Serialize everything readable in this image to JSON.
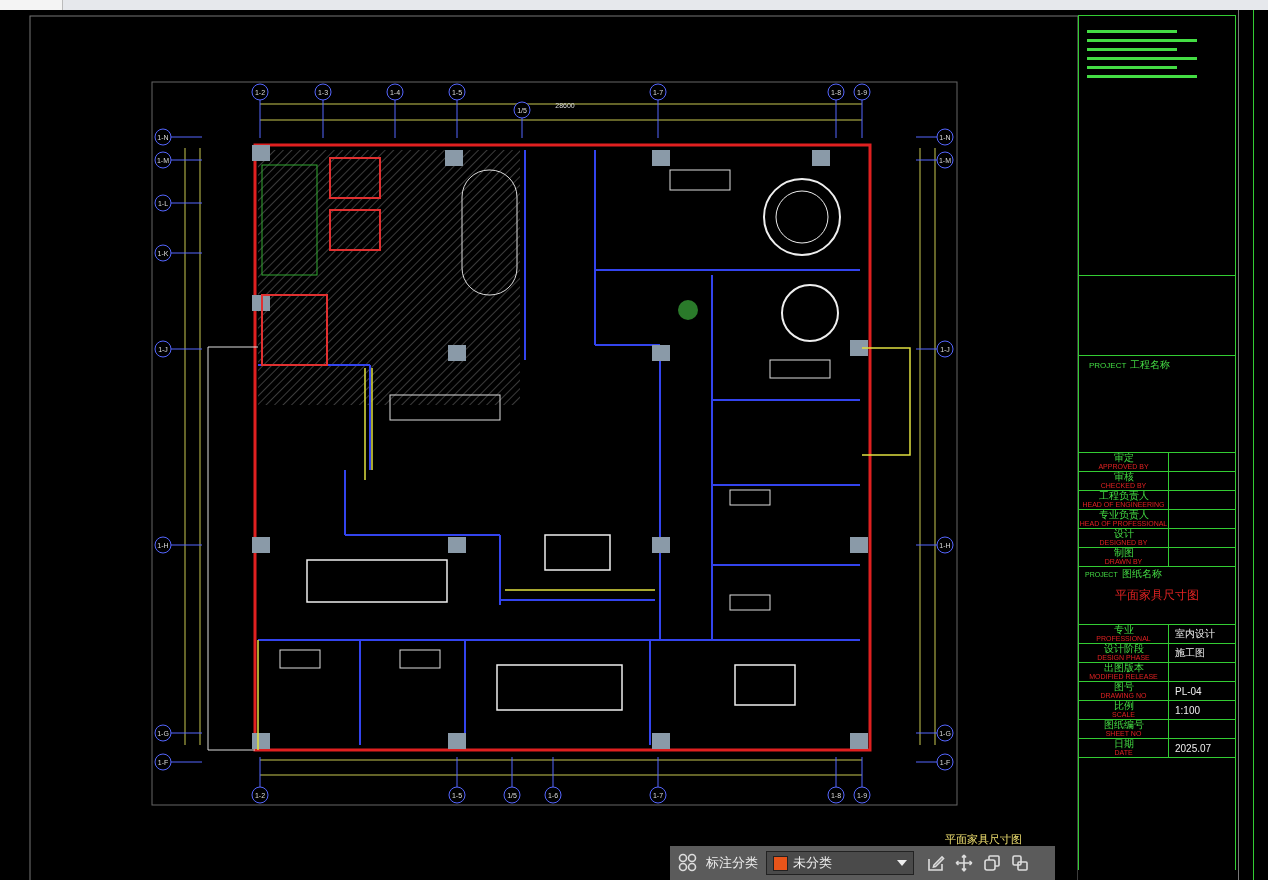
{
  "plan": {
    "top_axes": [
      "1-2",
      "1-3",
      "1-4",
      "1-5",
      "1/5",
      "1-7",
      "1-8",
      "1-9"
    ],
    "bottom_axes": [
      "1-2",
      "1-5",
      "1/5",
      "1-6",
      "1-7",
      "1-8",
      "1-9"
    ],
    "left_axes": [
      "1-N",
      "1-M",
      "1-L",
      "1-K",
      "1-J",
      "1-H",
      "1-G",
      "1-F"
    ],
    "right_axes": [
      "1-N",
      "1-M",
      "1-J",
      "1-H",
      "1-G",
      "1-F"
    ],
    "overall_dimension": "28600",
    "caption": "平面家具尺寸图"
  },
  "title_block": {
    "project_label": "PROJECT",
    "project_label_cn": "工程名称",
    "sign_rows": [
      {
        "cn": "审定",
        "en": "APPROVED BY"
      },
      {
        "cn": "审核",
        "en": "CHECKED BY"
      },
      {
        "cn": "工程负责人",
        "en": "HEAD OF ENGINEERING"
      },
      {
        "cn": "专业负责人",
        "en": "HEAD OF PROFESSIONAL"
      },
      {
        "cn": "设计",
        "en": "DESIGNED BY"
      },
      {
        "cn": "制图",
        "en": "DRAWN BY"
      }
    ],
    "drawing_label": "PROJECT",
    "drawing_label_cn": "图纸名称",
    "drawing_title": "平面家具尺寸图",
    "info_rows": [
      {
        "cn": "专业",
        "en": "PROFESSIONAL",
        "value": "室内设计"
      },
      {
        "cn": "设计阶段",
        "en": "DESIGN PHASE",
        "value": "施工图"
      },
      {
        "cn": "出图版本",
        "en": "MODIFIED RELEASE"
      },
      {
        "cn": "图号",
        "en": "DRAWING NO",
        "value": "PL-04"
      },
      {
        "cn": "比例",
        "en": "SCALE",
        "value": "1:100"
      },
      {
        "cn": "图纸编号",
        "en": "SHEET NO"
      },
      {
        "cn": "日期",
        "en": "DATE",
        "value": "2025.07"
      }
    ]
  },
  "toolbar": {
    "label": "标注分类",
    "category": {
      "value": "未分类",
      "color": "#e8541a"
    }
  }
}
